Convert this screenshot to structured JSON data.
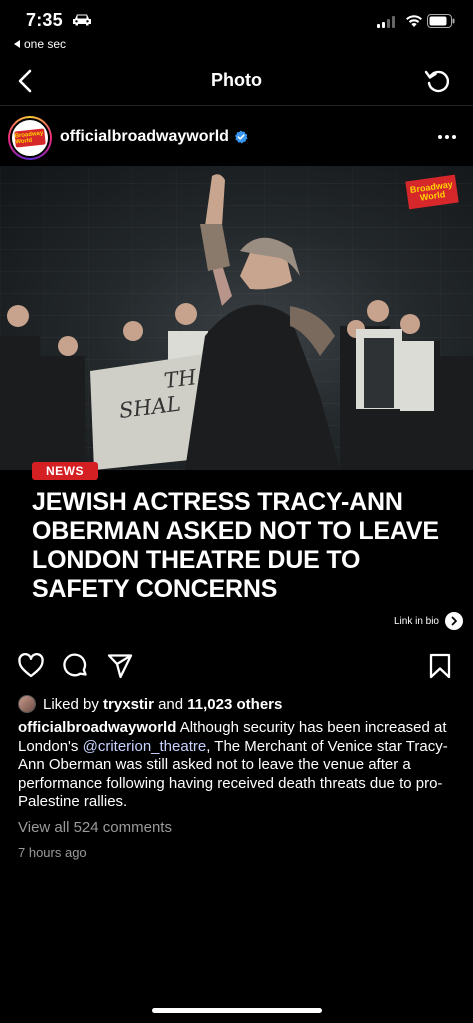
{
  "status_bar": {
    "time": "7:35",
    "back_app": "one sec"
  },
  "header": {
    "title": "Photo"
  },
  "post": {
    "username": "officialbroadwayworld",
    "avatar_logo_text": "Broadway World",
    "photo": {
      "badge_text": "Broadway World",
      "banner_text": "TH\nSHAL"
    },
    "news_tag": "NEWS",
    "headline": "JEWISH ACTRESS TRACY-ANN OBERMAN ASKED NOT TO LEAVE LONDON THEATRE DUE TO SAFETY CONCERNS",
    "link_in_bio": "Link in bio",
    "liked_by_prefix": "Liked by",
    "liked_by_user": "tryxstir",
    "liked_by_and": "and",
    "liked_by_count": "11,023 others",
    "caption_user": "officialbroadwayworld",
    "caption_part1": "Although security has been increased at London's",
    "caption_mention": "@criterion_theatre",
    "caption_part2": ", The Merchant of Venice star Tracy-Ann Oberman was still asked not to leave the venue after a performance following having received death threats due to pro-Palestine rallies.",
    "view_comments": "View all 524 comments",
    "time_ago": "7 hours ago"
  },
  "colors": {
    "background": "#000000",
    "news_tag": "#d41f23",
    "verified": "#3897f0",
    "mention": "#c8d2ff",
    "muted_text": "#9a9a9a"
  },
  "icons": [
    "car-icon",
    "signal-icon",
    "wifi-icon",
    "battery-icon",
    "back-chevron-icon",
    "refresh-icon",
    "verified-icon",
    "more-icon",
    "link-arrow-icon",
    "heart-icon",
    "comment-icon",
    "share-icon",
    "bookmark-icon"
  ]
}
